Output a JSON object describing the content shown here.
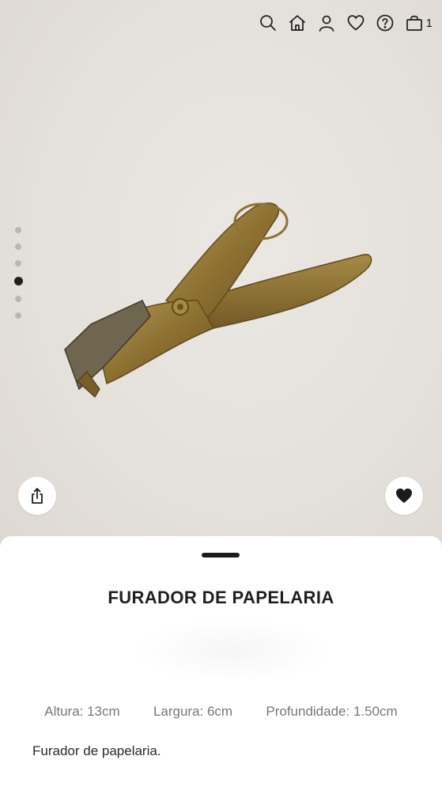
{
  "header": {
    "icons": [
      "search-icon",
      "home-icon",
      "user-icon",
      "heart-icon",
      "help-icon",
      "bag-icon"
    ],
    "cart_count": "1"
  },
  "gallery": {
    "dot_count": 6,
    "active_index": 3
  },
  "product": {
    "title": "FURADOR DE PAPELARIA",
    "dimensions": {
      "height": "Altura: 13cm",
      "width": "Largura: 6cm",
      "depth": "Profundidade: 1.50cm"
    },
    "description": "Furador de papelaria."
  },
  "colors": {
    "background": "#e7e3de",
    "sheet": "#ffffff",
    "text": "#1f1f1f",
    "muted": "#777777",
    "brass": "#9b7d3c"
  }
}
